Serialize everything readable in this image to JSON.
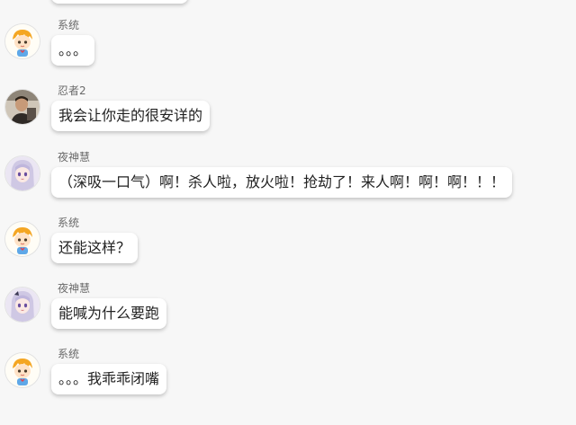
{
  "colors": {
    "background": "#f7f7f7",
    "bubble": "#ffffff",
    "name": "#6a6a6a",
    "text": "#222222"
  },
  "messages": [
    {
      "sender": "系统",
      "text": "。。。",
      "avatar_icon": "cartoon-boy-avatar-icon"
    },
    {
      "sender": "忍者2",
      "text": "我会让你走的很安详的",
      "avatar_icon": "man-photo-avatar-icon"
    },
    {
      "sender": "夜神慧",
      "text": "（深吸一口气）啊！杀人啦，放火啦！抢劫了！来人啊！啊！啊！！！",
      "avatar_icon": "anime-girl-avatar-icon"
    },
    {
      "sender": "系统",
      "text": "还能这样？",
      "avatar_icon": "cartoon-boy-avatar-icon"
    },
    {
      "sender": "夜神慧",
      "text": "能喊为什么要跑",
      "avatar_icon": "anime-girl-avatar-icon"
    },
    {
      "sender": "系统",
      "text": "。。。我乖乖闭嘴",
      "avatar_icon": "cartoon-boy-avatar-icon"
    }
  ]
}
